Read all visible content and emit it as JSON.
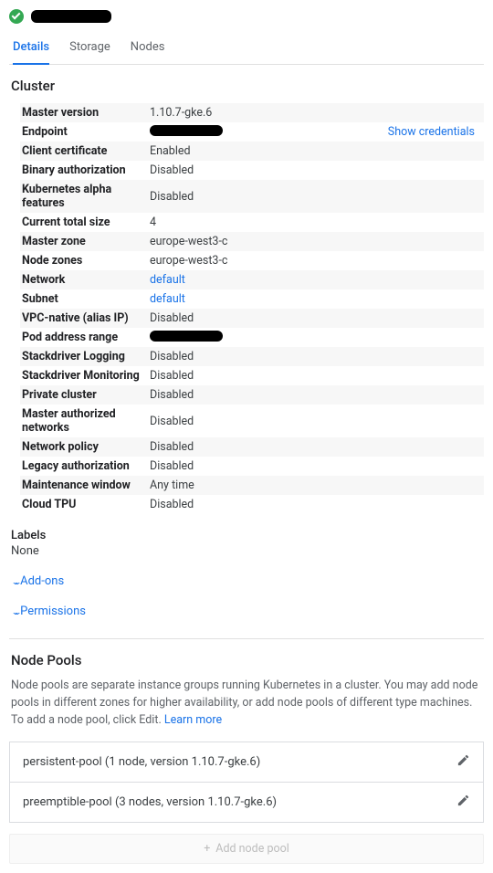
{
  "tabs": [
    "Details",
    "Storage",
    "Nodes"
  ],
  "section": "Cluster",
  "props": [
    {
      "k": "Master version",
      "v": "1.10.7-gke.6"
    },
    {
      "k": "Endpoint",
      "v": "__REDACT__",
      "cred": "Show credentials"
    },
    {
      "k": "Client certificate",
      "v": "Enabled"
    },
    {
      "k": "Binary authorization",
      "v": "Disabled"
    },
    {
      "k": "Kubernetes alpha features",
      "v": "Disabled"
    },
    {
      "k": "Current total size",
      "v": "4"
    },
    {
      "k": "Master zone",
      "v": "europe-west3-c"
    },
    {
      "k": "Node zones",
      "v": "europe-west3-c"
    },
    {
      "k": "Network",
      "v": "default",
      "link": true
    },
    {
      "k": "Subnet",
      "v": "default",
      "link": true
    },
    {
      "k": "VPC-native (alias IP)",
      "v": "Disabled"
    },
    {
      "k": "Pod address range",
      "v": "__REDACT__"
    },
    {
      "k": "Stackdriver Logging",
      "v": "Disabled"
    },
    {
      "k": "Stackdriver Monitoring",
      "v": "Disabled"
    },
    {
      "k": "Private cluster",
      "v": "Disabled"
    },
    {
      "k": "Master authorized networks",
      "v": "Disabled"
    },
    {
      "k": "Network policy",
      "v": "Disabled"
    },
    {
      "k": "Legacy authorization",
      "v": "Disabled"
    },
    {
      "k": "Maintenance window",
      "v": "Any time"
    },
    {
      "k": "Cloud TPU",
      "v": "Disabled"
    }
  ],
  "labels": {
    "title": "Labels",
    "value": "None"
  },
  "expanders": [
    "Add-ons",
    "Permissions"
  ],
  "nodePools": {
    "title": "Node Pools",
    "desc": "Node pools are separate instance groups running Kubernetes in a cluster. You may add node pools in different zones for higher availability, or add node pools of different type machines. To add a node pool, click Edit. ",
    "learn": "Learn more",
    "items": [
      "persistent-pool (1 node, version 1.10.7-gke.6)",
      "preemptible-pool (3 nodes, version 1.10.7-gke.6)"
    ],
    "add": "Add node pool"
  }
}
